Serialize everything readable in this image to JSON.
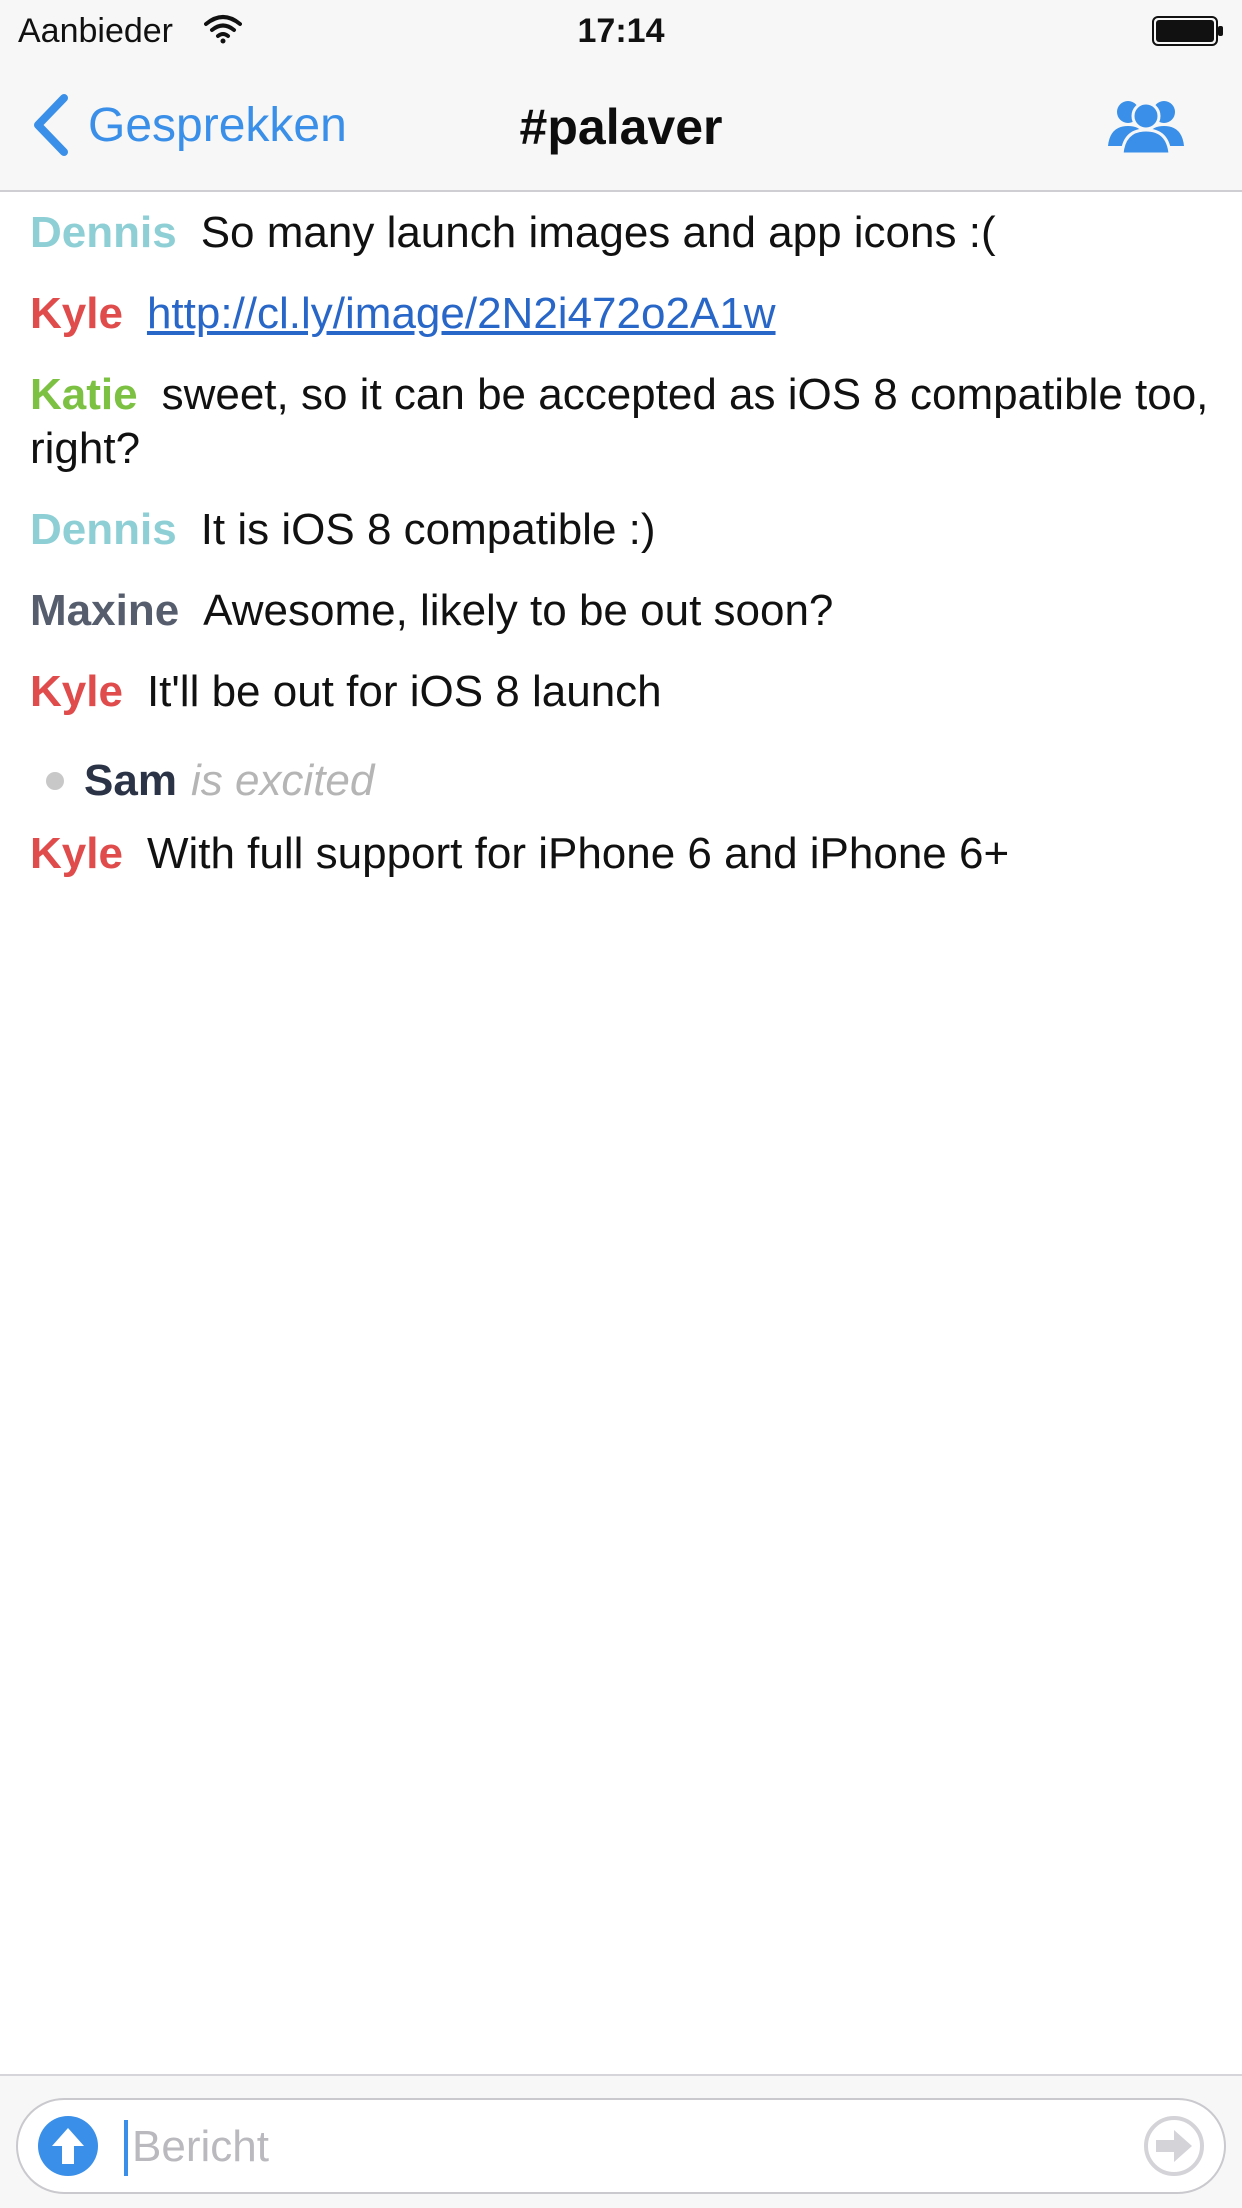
{
  "status_bar": {
    "carrier": "Aanbieder",
    "time": "17:14",
    "wifi_icon": "wifi-icon",
    "battery_icon": "battery-full-icon"
  },
  "nav": {
    "back_label": "Gesprekken",
    "title": "#palaver",
    "members_icon": "group-icon"
  },
  "colors": {
    "accent": "#3a8fe8",
    "nick_dennis": "#8ecfd6",
    "nick_kyle": "#e04b4b",
    "nick_katie": "#7cc142",
    "nick_maxine": "#565e6e",
    "nick_sam": "#2b3347",
    "link": "#2866c8"
  },
  "messages": [
    {
      "nick": "Dennis",
      "text": "So many launch images and app icons :("
    },
    {
      "nick": "Kyle",
      "link": "http://cl.ly/image/2N2i472o2A1w"
    },
    {
      "nick": "Katie",
      "text": "sweet, so it can be accepted as iOS 8 compatible too, right?"
    },
    {
      "nick": "Dennis",
      "text": "It is iOS 8 compatible :)"
    },
    {
      "nick": "Maxine",
      "text": "Awesome, likely to be out soon?"
    },
    {
      "nick": "Kyle",
      "text": "It'll be out for iOS 8 launch"
    },
    {
      "nick": "Sam",
      "action": "is excited"
    },
    {
      "nick": "Kyle",
      "text": "With full support for iPhone 6 and iPhone 6+"
    }
  ],
  "composer": {
    "placeholder": "Bericht",
    "value": "",
    "upload_icon": "upload-arrow-icon",
    "send_icon": "send-arrow-icon"
  }
}
